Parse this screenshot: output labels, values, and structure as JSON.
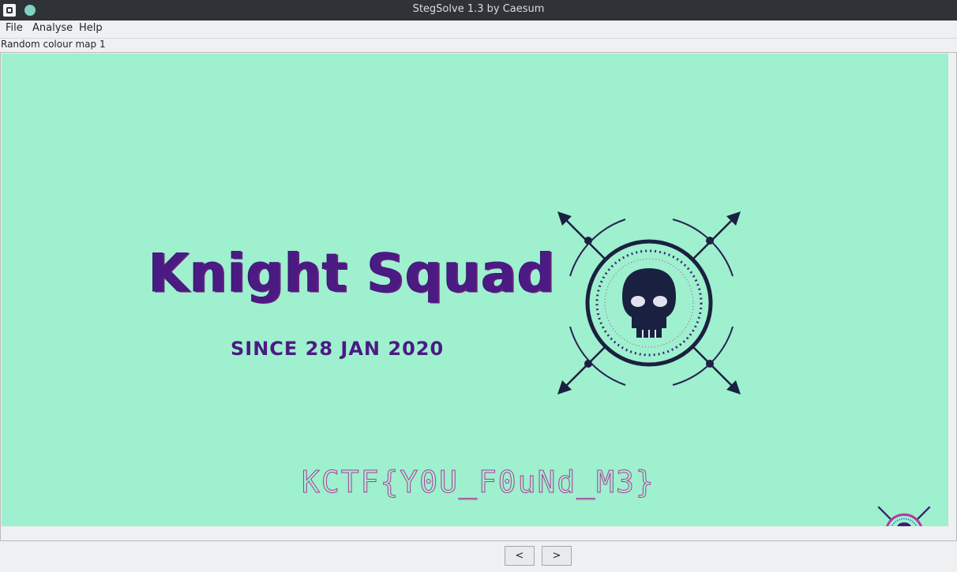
{
  "window": {
    "title": "StegSolve 1.3 by Caesum"
  },
  "menu": {
    "file": "File",
    "analyse": "Analyse",
    "help": "Help"
  },
  "plane_label": "Random colour map 1",
  "image": {
    "heading": "Knight Squad",
    "subheading": "SINCE 28 JAN 2020",
    "flag": "KCTF{Y0U_F0uNd_M3}"
  },
  "nav": {
    "prev": "<",
    "next": ">"
  },
  "colors": {
    "canvas_bg": "#9ef0cf",
    "text_purple": "#4b1a83",
    "flag_magenta": "#b2389a"
  }
}
